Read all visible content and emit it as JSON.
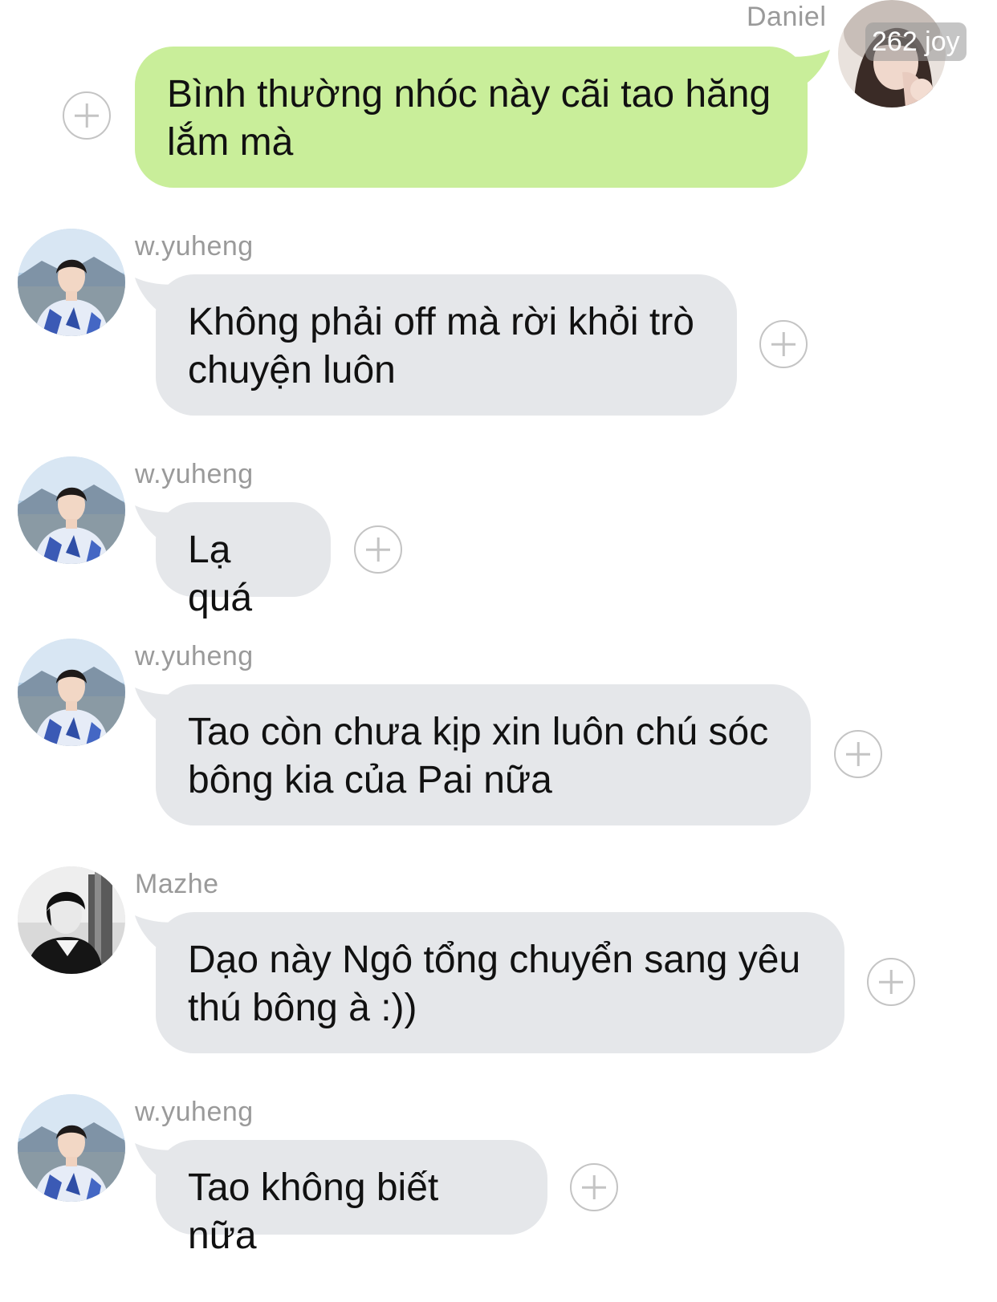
{
  "colors": {
    "incoming_bubble": "#e5e7ea",
    "outgoing_bubble": "#c9ee9a",
    "sender_name": "#9a9a9a",
    "message_text": "#111111",
    "plus_icon": "#c4c4c4"
  },
  "outgoing": {
    "sender": "Daniel",
    "badge": "262 joy",
    "text": "Bình thường nhóc này cãi tao hăng lắm mà"
  },
  "messages": [
    {
      "sender": "w.yuheng",
      "text": "Không phải off mà rời khỏi trò chuyện luôn"
    },
    {
      "sender": "w.yuheng",
      "text": "Lạ quá"
    },
    {
      "sender": "w.yuheng",
      "text": "Tao còn chưa kịp xin luôn chú sóc bông kia của Pai nữa"
    },
    {
      "sender": "Mazhe",
      "text": "Dạo này Ngô tổng chuyển sang yêu thú bông à :))"
    },
    {
      "sender": "w.yuheng",
      "text": "Tao không biết nữa"
    }
  ],
  "icons": {
    "reaction": "plus-circle-icon",
    "avatar_yuheng": "avatar-photo",
    "avatar_mazhe": "avatar-photo-bw",
    "avatar_daniel": "avatar-photo"
  }
}
